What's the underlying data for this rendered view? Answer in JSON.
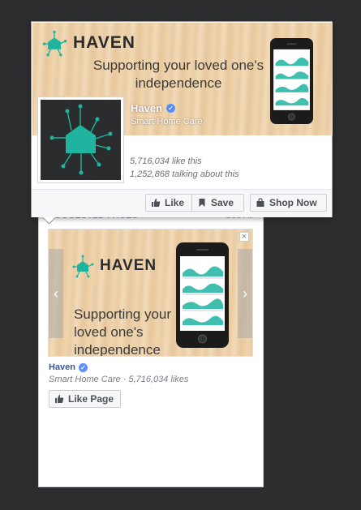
{
  "suggested": {
    "header_left": "SUGGESTED PAGES",
    "header_right": "See All",
    "ad": {
      "brand": "HAVEN",
      "tagline": "Supporting your loved one's independence"
    },
    "page_name": "Haven",
    "meta": "Smart Home Care · 5,716,034 likes",
    "like_page_label": "Like Page",
    "close_label": "×",
    "prev_label": "‹",
    "next_label": "›"
  },
  "popup": {
    "brand": "HAVEN",
    "tagline": "Supporting your loved one's independence",
    "page_name": "Haven",
    "category": "Smart Home Care",
    "likes": "5,716,034 like this",
    "talking": "1,252,868 talking about this",
    "buttons": {
      "like": "Like",
      "save": "Save",
      "shop": "Shop Now"
    }
  },
  "colors": {
    "accent": "#1fb3a0",
    "link": "#3b5998",
    "verified": "#5890ff",
    "background": "#2b2d2f"
  },
  "icons": [
    "haven-logo-icon",
    "verified-icon",
    "thumbs-up-icon",
    "bookmark-icon",
    "shopping-bag-icon",
    "phone-mockup",
    "close-icon"
  ]
}
